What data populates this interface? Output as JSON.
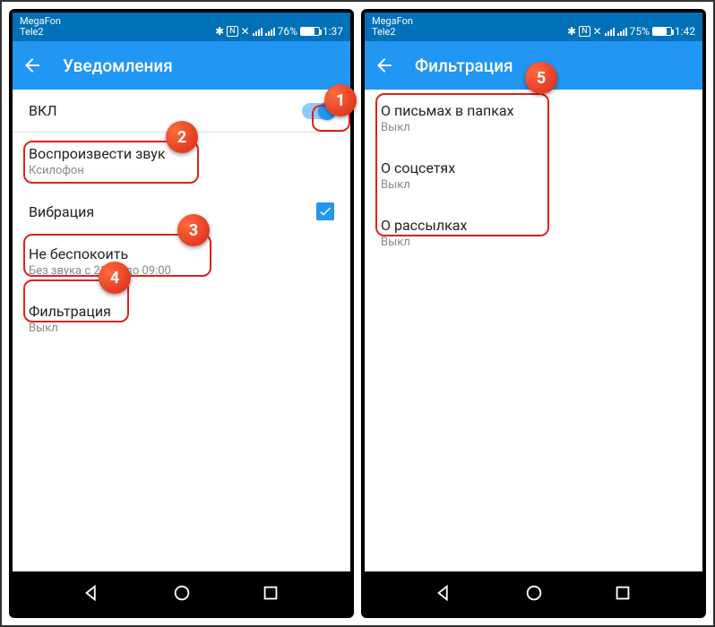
{
  "left": {
    "status": {
      "carrier1": "MegaFon",
      "carrier2": "Tele2",
      "battery": "76%",
      "time": "1:37"
    },
    "title": "Уведомления",
    "rows": {
      "enable": {
        "title": "ВКЛ"
      },
      "sound": {
        "title": "Воспроизвести звук",
        "sub": "Ксилофон"
      },
      "vibration": {
        "title": "Вибрация"
      },
      "dnd": {
        "title": "Не беспокоить",
        "sub": "Без звука с 21:00 до 09:00"
      },
      "filter": {
        "title": "Фильтрация",
        "sub": "Выкл"
      }
    }
  },
  "right": {
    "status": {
      "carrier1": "MegaFon",
      "carrier2": "Tele2",
      "battery": "75%",
      "time": "1:42"
    },
    "title": "Фильтрация",
    "rows": {
      "folders": {
        "title": "О письмах в папках",
        "sub": "Выкл"
      },
      "social": {
        "title": "О соцсетях",
        "sub": "Выкл"
      },
      "news": {
        "title": "О рассылках",
        "sub": "Выкл"
      }
    }
  },
  "badges": {
    "b1": "1",
    "b2": "2",
    "b3": "3",
    "b4": "4",
    "b5": "5"
  }
}
